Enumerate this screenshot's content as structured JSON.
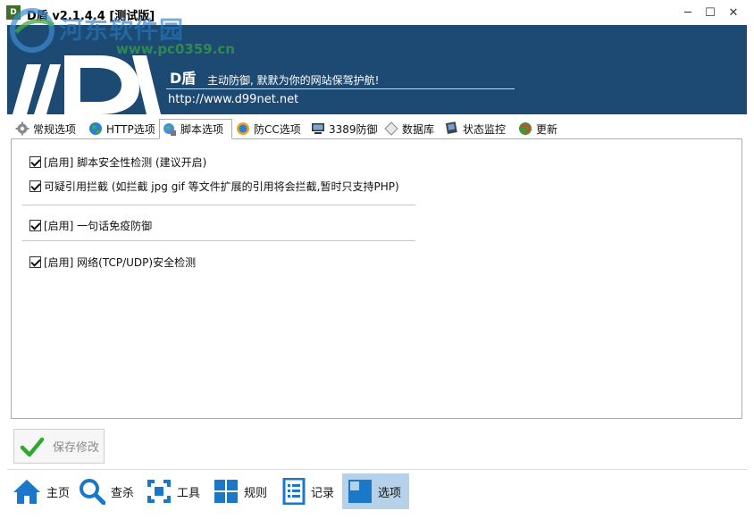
{
  "window": {
    "title": "D盾 v2.1.4.4 [测试版]",
    "watermark_text": "河东软件园",
    "watermark_url": "www.pc0359.cn",
    "controls": [
      "─",
      "☐",
      "✕"
    ]
  },
  "banner": {
    "brand": "D盾",
    "slogan": "主动防御, 默默为你的网站保驾护航!",
    "url": "http://www.d99net.net"
  },
  "tabs": [
    {
      "label": "常规选项",
      "icon": "gear-icon"
    },
    {
      "label": "HTTP选项",
      "icon": "globe-icon"
    },
    {
      "label": "脚本选项",
      "icon": "script-icon",
      "active": true
    },
    {
      "label": "防CC选项",
      "icon": "shield-globe-icon"
    },
    {
      "label": "3389防御",
      "icon": "monitor-icon"
    },
    {
      "label": "数据库",
      "icon": "database-icon"
    },
    {
      "label": "状态监控",
      "icon": "monitor-status-icon"
    },
    {
      "label": "更新",
      "icon": "update-icon"
    }
  ],
  "options": [
    {
      "label": "[启用] 脚本安全性检测 (建议开启)",
      "checked": true
    },
    {
      "label": "可疑引用拦截 (如拦截 jpg gif 等文件扩展的引用将会拦截,暂时只支持PHP)",
      "checked": true
    },
    {
      "label": "[启用] 一句话免疫防御",
      "checked": true
    },
    {
      "label": "[启用] 网络(TCP/UDP)安全检测",
      "checked": true
    }
  ],
  "save_button": {
    "label": "保存修改"
  },
  "bottom_nav": [
    {
      "label": "主页",
      "icon": "home-icon"
    },
    {
      "label": "查杀",
      "icon": "search-icon"
    },
    {
      "label": "工具",
      "icon": "tools-icon"
    },
    {
      "label": "规则",
      "icon": "rules-icon"
    },
    {
      "label": "记录",
      "icon": "log-icon"
    },
    {
      "label": "选项",
      "icon": "options-icon",
      "active": true
    }
  ],
  "colors": {
    "banner_bg": "#1c4a73",
    "nav_active_bg": "#b6d2ea",
    "icon_blue": "#1b78c8"
  }
}
